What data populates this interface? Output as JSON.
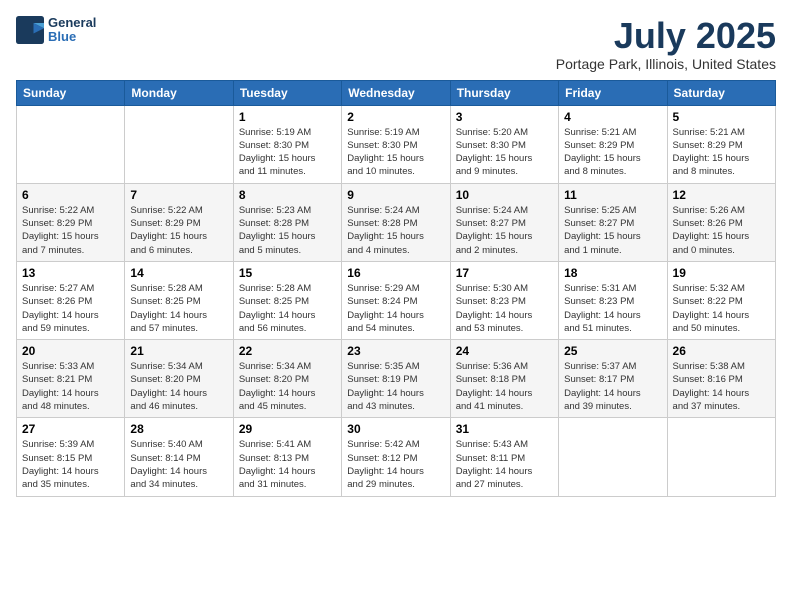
{
  "header": {
    "logo_line1": "General",
    "logo_line2": "Blue",
    "month_year": "July 2025",
    "location": "Portage Park, Illinois, United States"
  },
  "weekdays": [
    "Sunday",
    "Monday",
    "Tuesday",
    "Wednesday",
    "Thursday",
    "Friday",
    "Saturday"
  ],
  "weeks": [
    [
      {
        "day": "",
        "info": ""
      },
      {
        "day": "",
        "info": ""
      },
      {
        "day": "1",
        "info": "Sunrise: 5:19 AM\nSunset: 8:30 PM\nDaylight: 15 hours\nand 11 minutes."
      },
      {
        "day": "2",
        "info": "Sunrise: 5:19 AM\nSunset: 8:30 PM\nDaylight: 15 hours\nand 10 minutes."
      },
      {
        "day": "3",
        "info": "Sunrise: 5:20 AM\nSunset: 8:30 PM\nDaylight: 15 hours\nand 9 minutes."
      },
      {
        "day": "4",
        "info": "Sunrise: 5:21 AM\nSunset: 8:29 PM\nDaylight: 15 hours\nand 8 minutes."
      },
      {
        "day": "5",
        "info": "Sunrise: 5:21 AM\nSunset: 8:29 PM\nDaylight: 15 hours\nand 8 minutes."
      }
    ],
    [
      {
        "day": "6",
        "info": "Sunrise: 5:22 AM\nSunset: 8:29 PM\nDaylight: 15 hours\nand 7 minutes."
      },
      {
        "day": "7",
        "info": "Sunrise: 5:22 AM\nSunset: 8:29 PM\nDaylight: 15 hours\nand 6 minutes."
      },
      {
        "day": "8",
        "info": "Sunrise: 5:23 AM\nSunset: 8:28 PM\nDaylight: 15 hours\nand 5 minutes."
      },
      {
        "day": "9",
        "info": "Sunrise: 5:24 AM\nSunset: 8:28 PM\nDaylight: 15 hours\nand 4 minutes."
      },
      {
        "day": "10",
        "info": "Sunrise: 5:24 AM\nSunset: 8:27 PM\nDaylight: 15 hours\nand 2 minutes."
      },
      {
        "day": "11",
        "info": "Sunrise: 5:25 AM\nSunset: 8:27 PM\nDaylight: 15 hours\nand 1 minute."
      },
      {
        "day": "12",
        "info": "Sunrise: 5:26 AM\nSunset: 8:26 PM\nDaylight: 15 hours\nand 0 minutes."
      }
    ],
    [
      {
        "day": "13",
        "info": "Sunrise: 5:27 AM\nSunset: 8:26 PM\nDaylight: 14 hours\nand 59 minutes."
      },
      {
        "day": "14",
        "info": "Sunrise: 5:28 AM\nSunset: 8:25 PM\nDaylight: 14 hours\nand 57 minutes."
      },
      {
        "day": "15",
        "info": "Sunrise: 5:28 AM\nSunset: 8:25 PM\nDaylight: 14 hours\nand 56 minutes."
      },
      {
        "day": "16",
        "info": "Sunrise: 5:29 AM\nSunset: 8:24 PM\nDaylight: 14 hours\nand 54 minutes."
      },
      {
        "day": "17",
        "info": "Sunrise: 5:30 AM\nSunset: 8:23 PM\nDaylight: 14 hours\nand 53 minutes."
      },
      {
        "day": "18",
        "info": "Sunrise: 5:31 AM\nSunset: 8:23 PM\nDaylight: 14 hours\nand 51 minutes."
      },
      {
        "day": "19",
        "info": "Sunrise: 5:32 AM\nSunset: 8:22 PM\nDaylight: 14 hours\nand 50 minutes."
      }
    ],
    [
      {
        "day": "20",
        "info": "Sunrise: 5:33 AM\nSunset: 8:21 PM\nDaylight: 14 hours\nand 48 minutes."
      },
      {
        "day": "21",
        "info": "Sunrise: 5:34 AM\nSunset: 8:20 PM\nDaylight: 14 hours\nand 46 minutes."
      },
      {
        "day": "22",
        "info": "Sunrise: 5:34 AM\nSunset: 8:20 PM\nDaylight: 14 hours\nand 45 minutes."
      },
      {
        "day": "23",
        "info": "Sunrise: 5:35 AM\nSunset: 8:19 PM\nDaylight: 14 hours\nand 43 minutes."
      },
      {
        "day": "24",
        "info": "Sunrise: 5:36 AM\nSunset: 8:18 PM\nDaylight: 14 hours\nand 41 minutes."
      },
      {
        "day": "25",
        "info": "Sunrise: 5:37 AM\nSunset: 8:17 PM\nDaylight: 14 hours\nand 39 minutes."
      },
      {
        "day": "26",
        "info": "Sunrise: 5:38 AM\nSunset: 8:16 PM\nDaylight: 14 hours\nand 37 minutes."
      }
    ],
    [
      {
        "day": "27",
        "info": "Sunrise: 5:39 AM\nSunset: 8:15 PM\nDaylight: 14 hours\nand 35 minutes."
      },
      {
        "day": "28",
        "info": "Sunrise: 5:40 AM\nSunset: 8:14 PM\nDaylight: 14 hours\nand 34 minutes."
      },
      {
        "day": "29",
        "info": "Sunrise: 5:41 AM\nSunset: 8:13 PM\nDaylight: 14 hours\nand 31 minutes."
      },
      {
        "day": "30",
        "info": "Sunrise: 5:42 AM\nSunset: 8:12 PM\nDaylight: 14 hours\nand 29 minutes."
      },
      {
        "day": "31",
        "info": "Sunrise: 5:43 AM\nSunset: 8:11 PM\nDaylight: 14 hours\nand 27 minutes."
      },
      {
        "day": "",
        "info": ""
      },
      {
        "day": "",
        "info": ""
      }
    ]
  ]
}
